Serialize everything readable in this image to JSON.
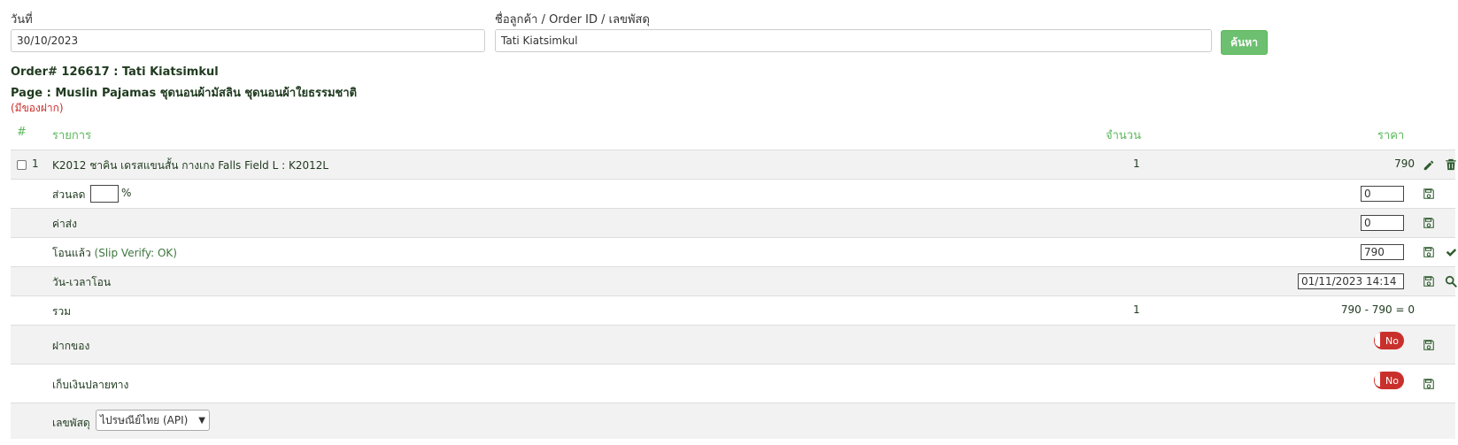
{
  "search": {
    "date_label": "วันที่",
    "date_value": "30/10/2023",
    "customer_label": "ชื่อลูกค้า / Order ID / เลขพัสดุ",
    "customer_value": "Tati Kiatsimkul",
    "search_button": "ค้นหา"
  },
  "order": {
    "title": "Order# 126617 : Tati Kiatsimkul",
    "page": "Page : Muslin Pajamas ชุดนอนผ้ามัสลิน ชุดนอนผ้าใยธรรมชาติ",
    "note": "(มีของฝาก)"
  },
  "table": {
    "headers": {
      "num": "#",
      "item": "รายการ",
      "qty": "จำนวน",
      "price": "ราคา"
    },
    "item": {
      "index": "1",
      "name": "K2012 ชาคิน เดรสแขนสั้น กางเกง Falls Field L : K2012L",
      "qty": "1",
      "price": "790"
    },
    "discount": {
      "label": "ส่วนลด",
      "percent_value": "",
      "percent_sign": "%",
      "value": "0"
    },
    "shipping": {
      "label": "ค่าส่ง",
      "value": "0"
    },
    "transfer": {
      "label": "โอนแล้ว",
      "verify": "(Slip Verify: OK)",
      "value": "790"
    },
    "transfer_time": {
      "label": "วัน-เวลาโอน",
      "value": "01/11/2023 14:14"
    },
    "total": {
      "label": "รวม",
      "qty": "1",
      "summary": "790 - 790 = 0"
    },
    "deposit": {
      "label": "ฝากของ",
      "toggle": "No"
    },
    "cod": {
      "label": "เก็บเงินปลายทาง",
      "toggle": "No"
    },
    "tracking": {
      "label": "เลขพัสดุ",
      "carrier": "ไปรษณีย์ไทย (API)"
    }
  },
  "colors": {
    "accent_green": "#5cb85c",
    "danger_red": "#c9302c",
    "row_alt": "#f2f2f2"
  }
}
